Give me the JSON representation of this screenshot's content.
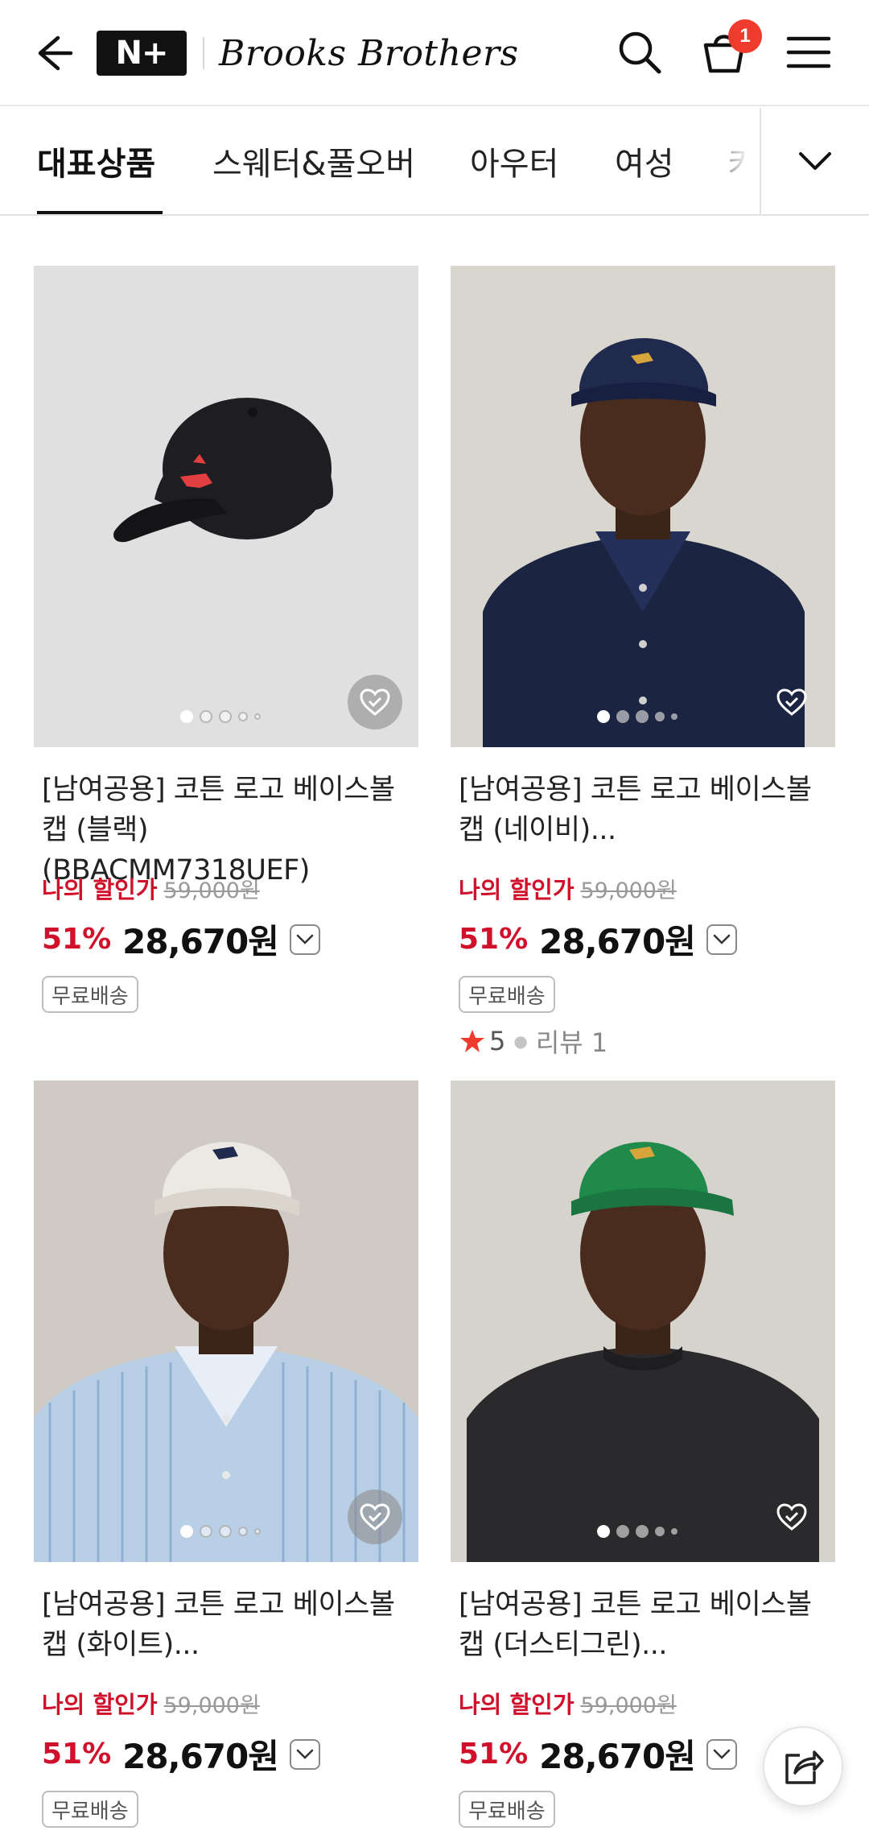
{
  "header": {
    "logo_text": "N+",
    "brand_name": "Brooks Brothers",
    "cart_count": "1"
  },
  "tabs": [
    {
      "label": "대표상품",
      "active": true
    },
    {
      "label": "스웨터&풀오버",
      "active": false
    },
    {
      "label": "아우터",
      "active": false
    },
    {
      "label": "여성",
      "active": false
    },
    {
      "label": "키",
      "active": false
    }
  ],
  "products": [
    {
      "title": "[남여공용] 코튼 로고 베이스볼 캡 (블랙) (BBACMM7318UEF)",
      "my_sale_label": "나의 할인가",
      "original_price": "59,000원",
      "discount": "51%",
      "price": "28,670원",
      "shipping": "무료배송",
      "cap_color": "#1d1d22",
      "logo_color": "#e0403f",
      "bg": "#e0e0e0",
      "has_rating": false,
      "image_dots": 5,
      "active_dot": 0
    },
    {
      "title": "[남여공용] 코튼 로고 베이스볼 캡 (네이비)...",
      "my_sale_label": "나의 할인가",
      "original_price": "59,000원",
      "discount": "51%",
      "price": "28,670원",
      "shipping": "무료배송",
      "cap_color": "#1f2a4e",
      "logo_color": "#d8a53a",
      "bg": "#d9d5cf",
      "rating": "5",
      "review": "리뷰 1",
      "has_rating": true,
      "image_dots": 5,
      "active_dot": 0
    },
    {
      "title": "[남여공용] 코튼 로고 베이스볼 캡 (화이트)...",
      "my_sale_label": "나의 할인가",
      "original_price": "59,000원",
      "discount": "51%",
      "price": "28,670원",
      "shipping": "무료배송",
      "cap_color": "#ece9e2",
      "logo_color": "#1f2a4e",
      "bg": "#cfcac3",
      "has_rating": false,
      "image_dots": 5,
      "active_dot": 0
    },
    {
      "title": "[남여공용] 코튼 로고 베이스볼 캡 (더스티그린)...",
      "my_sale_label": "나의 할인가",
      "original_price": "59,000원",
      "discount": "51%",
      "price": "28,670원",
      "shipping": "무료배송",
      "cap_color": "#1f8a4a",
      "logo_color": "#d8a53a",
      "bg": "#d6d2cc",
      "has_rating": false,
      "image_dots": 5,
      "active_dot": 0
    }
  ],
  "colors": {
    "sale_red": "#d0112b",
    "badge_red": "#ef3b2d",
    "text_dark": "#111111"
  },
  "icons": [
    "back-arrow-icon",
    "search-icon",
    "cart-icon",
    "hamburger-menu-icon",
    "chevron-down-icon",
    "heart-check-icon",
    "star-icon",
    "share-icon"
  ]
}
